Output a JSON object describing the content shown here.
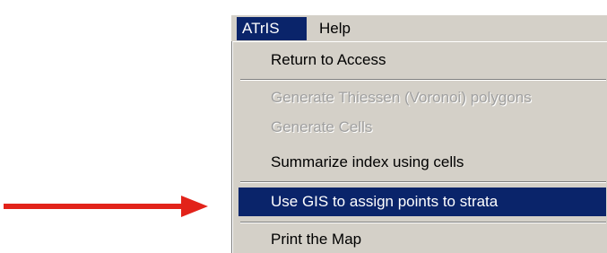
{
  "menubar": {
    "atris_label": "ATrIS",
    "help_label": "Help"
  },
  "menu": {
    "items": [
      {
        "label": "Return to Access",
        "state": "enabled"
      },
      {
        "label": "Generate Thiessen (Voronoi) polygons",
        "state": "disabled"
      },
      {
        "label": "Generate Cells",
        "state": "disabled"
      },
      {
        "label": "Summarize index using cells",
        "state": "enabled"
      },
      {
        "label": "Use GIS to assign points to strata",
        "state": "highlighted"
      },
      {
        "label": "Print the Map",
        "state": "enabled"
      }
    ]
  },
  "annotation": {
    "arrow_color": "#e2231a",
    "arrow_icon": "right-arrow-icon",
    "points_to": "Use GIS to assign points to strata"
  },
  "colors": {
    "menu_background": "#d4d0c8",
    "highlight": "#0a246a",
    "disabled_text": "#a0a0a0"
  }
}
